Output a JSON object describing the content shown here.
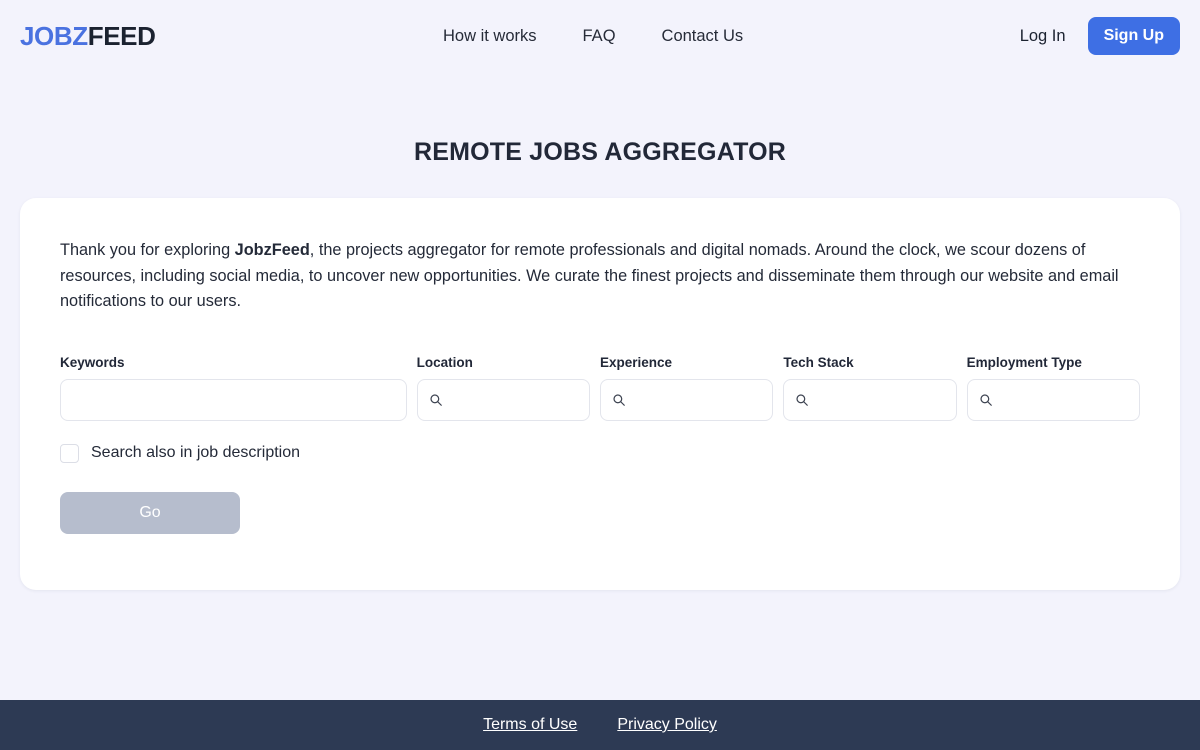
{
  "header": {
    "logo": {
      "part1": "JOBZ",
      "part2": "FEED"
    },
    "nav": [
      {
        "label": "How it works"
      },
      {
        "label": "FAQ"
      },
      {
        "label": "Contact Us"
      }
    ],
    "auth": {
      "login_label": "Log In",
      "signup_label": "Sign Up"
    }
  },
  "main": {
    "title": "REMOTE JOBS AGGREGATOR",
    "intro": {
      "before": "Thank you for exploring ",
      "brand": "JobzFeed",
      "after": ", the projects aggregator for remote professionals and digital nomads. Around the clock, we scour dozens of resources, including social media, to uncover new opportunities. We curate the finest projects and disseminate them through our website and email notifications to our users."
    },
    "fields": [
      {
        "label": "Keywords",
        "value": "",
        "placeholder": "",
        "icon": "none"
      },
      {
        "label": "Location",
        "value": "",
        "placeholder": "",
        "icon": "search-icon"
      },
      {
        "label": "Experience",
        "value": "",
        "placeholder": "",
        "icon": "search-icon"
      },
      {
        "label": "Tech Stack",
        "value": "",
        "placeholder": "",
        "icon": "search-icon"
      },
      {
        "label": "Employment Type",
        "value": "",
        "placeholder": "",
        "icon": "search-icon"
      }
    ],
    "checkbox": {
      "label": "Search also in job description",
      "checked": false
    },
    "submit": {
      "label": "Go",
      "disabled": true
    }
  },
  "footer": {
    "links": [
      {
        "label": "Terms of Use"
      },
      {
        "label": "Privacy Policy"
      }
    ]
  },
  "colors": {
    "page_background": "#f3f3fc",
    "card_background": "#ffffff",
    "accent_blue": "#3e6fe4",
    "logo_blue": "#4a72e0",
    "text_dark": "#1b2230",
    "footer_background": "#2d3a54",
    "button_disabled": "#b6bdcd",
    "input_border": "#e3e5ec"
  }
}
